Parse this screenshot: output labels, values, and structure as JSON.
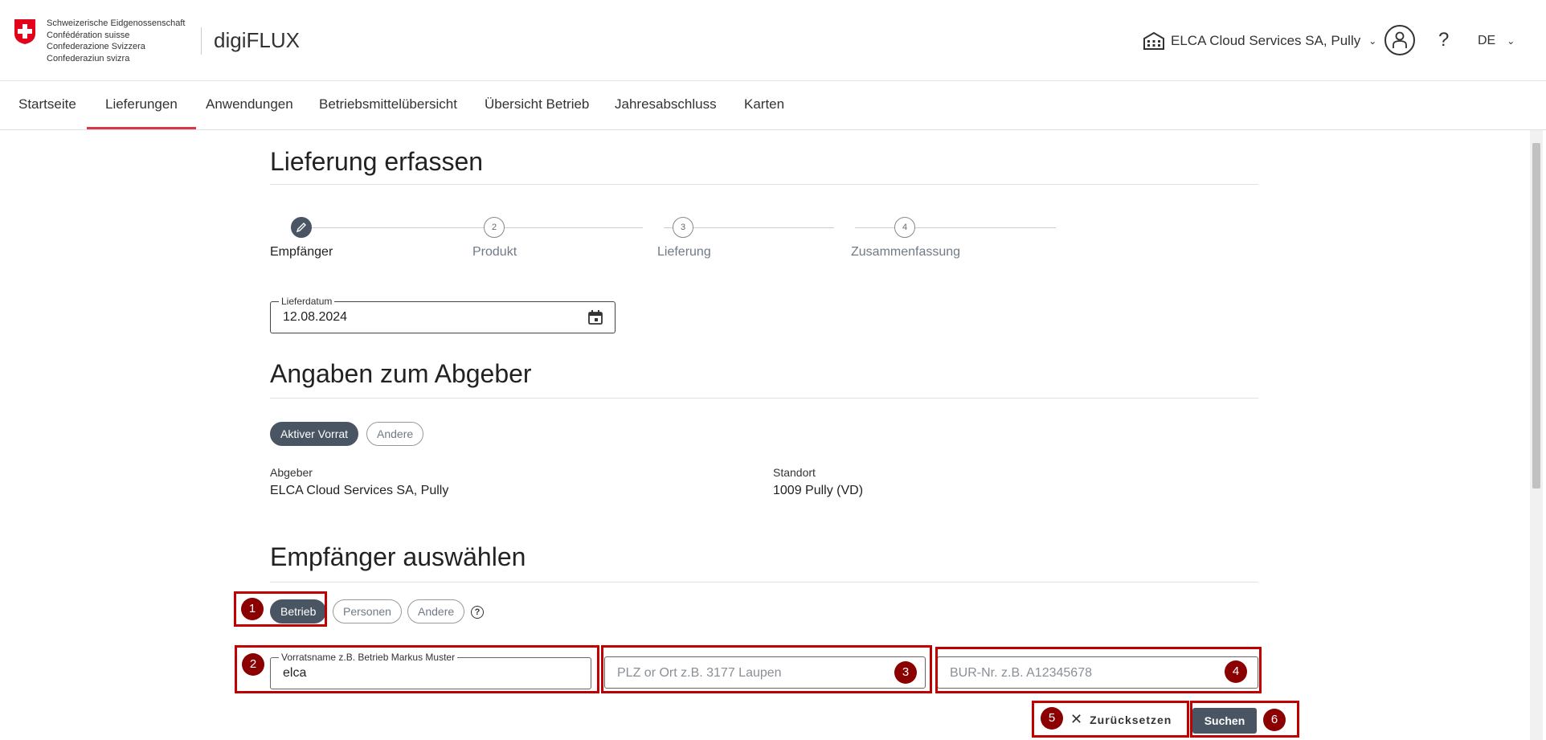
{
  "header": {
    "confederation_lines": [
      "Schweizerische Eidgenossenschaft",
      "Confédération suisse",
      "Confederazione Svizzera",
      "Confederaziun svizra"
    ],
    "app_name": "digiFLUX",
    "organization": "ELCA Cloud Services SA, Pully",
    "help": "?",
    "language": "DE"
  },
  "nav": {
    "items": [
      {
        "label": "Startseite"
      },
      {
        "label": "Lieferungen",
        "active": true
      },
      {
        "label": "Anwendungen"
      },
      {
        "label": "Betriebsmittelübersicht"
      },
      {
        "label": "Übersicht Betrieb"
      },
      {
        "label": "Jahresabschluss"
      },
      {
        "label": "Karten"
      }
    ]
  },
  "page": {
    "title": "Lieferung erfassen",
    "steps": [
      {
        "number": "",
        "label": "Empfänger",
        "active": true
      },
      {
        "number": "2",
        "label": "Produkt"
      },
      {
        "number": "3",
        "label": "Lieferung"
      },
      {
        "number": "4",
        "label": "Zusammenfassung"
      }
    ],
    "delivery_date": {
      "label": "Lieferdatum",
      "value": "12.08.2024"
    }
  },
  "giver": {
    "title": "Angaben zum Abgeber",
    "toggle": {
      "active": "Aktiver Vorrat",
      "other": "Andere"
    },
    "abgeber_label": "Abgeber",
    "abgeber_value": "ELCA Cloud Services SA, Pully",
    "standort_label": "Standort",
    "standort_value": "1009 Pully (VD)"
  },
  "recipient": {
    "title": "Empfänger auswählen",
    "toggle": {
      "betrieb": "Betrieb",
      "personen": "Personen",
      "andere": "Andere"
    },
    "help": "?",
    "name_field": {
      "label": "Vorratsname z.B. Betrieb Markus Muster",
      "value": "elca"
    },
    "plz_field": {
      "placeholder": "PLZ or Ort z.B. 3177 Laupen"
    },
    "bur_field": {
      "placeholder": "BUR-Nr. z.B. A12345678"
    },
    "reset_label": "Zurücksetzen",
    "search_label": "Suchen"
  },
  "annotations": [
    "1",
    "2",
    "3",
    "4",
    "5",
    "6"
  ],
  "colors": {
    "accent": "#dc3545",
    "primary": "#4a5564",
    "annotation": "#c00000",
    "badge": "#8b0000"
  }
}
